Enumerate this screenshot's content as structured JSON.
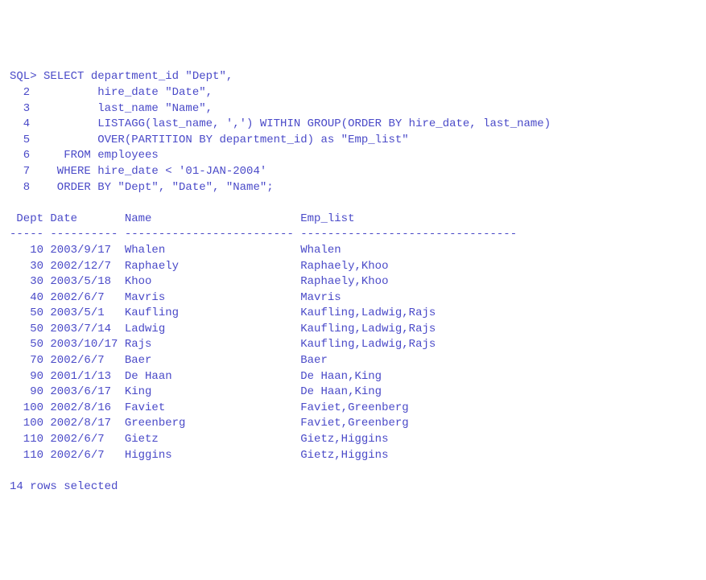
{
  "prompt": "SQL>",
  "query_lines": [
    {
      "num": "SQL>",
      "text": " SELECT department_id \"Dept\","
    },
    {
      "num": "  2  ",
      "text": "        hire_date \"Date\","
    },
    {
      "num": "  3  ",
      "text": "        last_name \"Name\","
    },
    {
      "num": "  4  ",
      "text": "        LISTAGG(last_name, ',') WITHIN GROUP(ORDER BY hire_date, last_name)"
    },
    {
      "num": "  5  ",
      "text": "        OVER(PARTITION BY department_id) as \"Emp_list\""
    },
    {
      "num": "  6  ",
      "text": "   FROM employees"
    },
    {
      "num": "  7  ",
      "text": "  WHERE hire_date < '01-JAN-2004'"
    },
    {
      "num": "  8  ",
      "text": "  ORDER BY \"Dept\", \"Date\", \"Name\";"
    }
  ],
  "columns": {
    "c1": "Dept",
    "c2": "Date",
    "c3": "Name",
    "c4": "Emp_list"
  },
  "header_line": " Dept Date       Name                      Emp_list",
  "sep_line": "----- ---------- ------------------------- --------------------------------",
  "rows": [
    {
      "dept": "10",
      "date": "2003/9/17",
      "name": "Whalen",
      "emp_list": "Whalen"
    },
    {
      "dept": "30",
      "date": "2002/12/7",
      "name": "Raphaely",
      "emp_list": "Raphaely,Khoo"
    },
    {
      "dept": "30",
      "date": "2003/5/18",
      "name": "Khoo",
      "emp_list": "Raphaely,Khoo"
    },
    {
      "dept": "40",
      "date": "2002/6/7",
      "name": "Mavris",
      "emp_list": "Mavris"
    },
    {
      "dept": "50",
      "date": "2003/5/1",
      "name": "Kaufling",
      "emp_list": "Kaufling,Ladwig,Rajs"
    },
    {
      "dept": "50",
      "date": "2003/7/14",
      "name": "Ladwig",
      "emp_list": "Kaufling,Ladwig,Rajs"
    },
    {
      "dept": "50",
      "date": "2003/10/17",
      "name": "Rajs",
      "emp_list": "Kaufling,Ladwig,Rajs"
    },
    {
      "dept": "70",
      "date": "2002/6/7",
      "name": "Baer",
      "emp_list": "Baer"
    },
    {
      "dept": "90",
      "date": "2001/1/13",
      "name": "De Haan",
      "emp_list": "De Haan,King"
    },
    {
      "dept": "90",
      "date": "2003/6/17",
      "name": "King",
      "emp_list": "De Haan,King"
    },
    {
      "dept": "100",
      "date": "2002/8/16",
      "name": "Faviet",
      "emp_list": "Faviet,Greenberg"
    },
    {
      "dept": "100",
      "date": "2002/8/17",
      "name": "Greenberg",
      "emp_list": "Faviet,Greenberg"
    },
    {
      "dept": "110",
      "date": "2002/6/7",
      "name": "Gietz",
      "emp_list": "Gietz,Higgins"
    },
    {
      "dept": "110",
      "date": "2002/6/7",
      "name": "Higgins",
      "emp_list": "Gietz,Higgins"
    }
  ],
  "footer": "14 rows selected"
}
